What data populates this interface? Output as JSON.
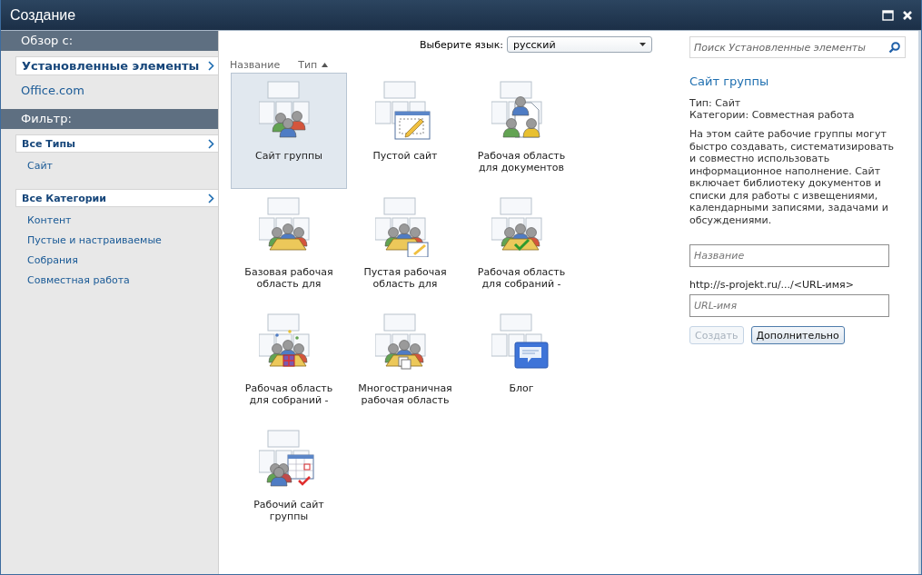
{
  "window": {
    "title": "Создание"
  },
  "sidebar": {
    "browse": {
      "heading": "Обзор с:",
      "items": [
        {
          "label": "Установленные элементы",
          "selected": true
        },
        {
          "label": "Office.com",
          "selected": false
        }
      ]
    },
    "filter": {
      "heading": "Фильтр:",
      "groups": [
        {
          "label": "Все Типы",
          "selected": true,
          "children": [
            {
              "label": "Сайт",
              "selected": false
            }
          ]
        },
        {
          "label": "Все Категории",
          "selected": true,
          "children": [
            {
              "label": "Контент",
              "selected": false
            },
            {
              "label": "Пустые и настраиваемые",
              "selected": false
            },
            {
              "label": "Собрания",
              "selected": false
            },
            {
              "label": "Совместная работа",
              "selected": false
            }
          ]
        }
      ]
    }
  },
  "language": {
    "label": "Выберите язык:",
    "value": "русский"
  },
  "sort_columns": [
    {
      "label": "Название",
      "sorted": false
    },
    {
      "label": "Тип",
      "sorted": true
    }
  ],
  "templates": [
    {
      "label": "Сайт группы",
      "kind": "people",
      "selected": true
    },
    {
      "label": "Пустой сайт",
      "kind": "edit",
      "selected": false
    },
    {
      "label": "Рабочая область для документов",
      "kind": "document",
      "selected": false
    },
    {
      "label": "Базовая рабочая область для",
      "kind": "meeting",
      "selected": false
    },
    {
      "label": "Пустая рабочая область для",
      "kind": "meeting-edit",
      "selected": false
    },
    {
      "label": "Рабочая область для собраний -",
      "kind": "meeting-check",
      "selected": false
    },
    {
      "label": "Рабочая область для собраний -",
      "kind": "meeting-gift",
      "selected": false
    },
    {
      "label": "Многостраничная рабочая область",
      "kind": "meeting-pages",
      "selected": false
    },
    {
      "label": "Блог",
      "kind": "blog",
      "selected": false
    },
    {
      "label": "Рабочий сайт группы",
      "kind": "calendar",
      "selected": false
    }
  ],
  "details": {
    "search_placeholder": "Поиск Установленные элементы",
    "title": "Сайт группы",
    "type": "Тип: Сайт",
    "categories": "Категории: Совместная работа",
    "description": "На этом сайте рабочие группы могут быстро создавать, систематизировать и совместно использовать информационное наполнение. Сайт включает библиотеку документов и списки для работы с извещениями, календарными записями, задачами и обсуждениями.",
    "name_placeholder": "Название",
    "url_prefix": "http://s-projekt.ru/.../<URL-имя>",
    "url_placeholder": "URL-имя",
    "buttons": [
      {
        "label": "Создать",
        "disabled": true
      },
      {
        "label": "Дополнительно",
        "disabled": false
      }
    ]
  }
}
